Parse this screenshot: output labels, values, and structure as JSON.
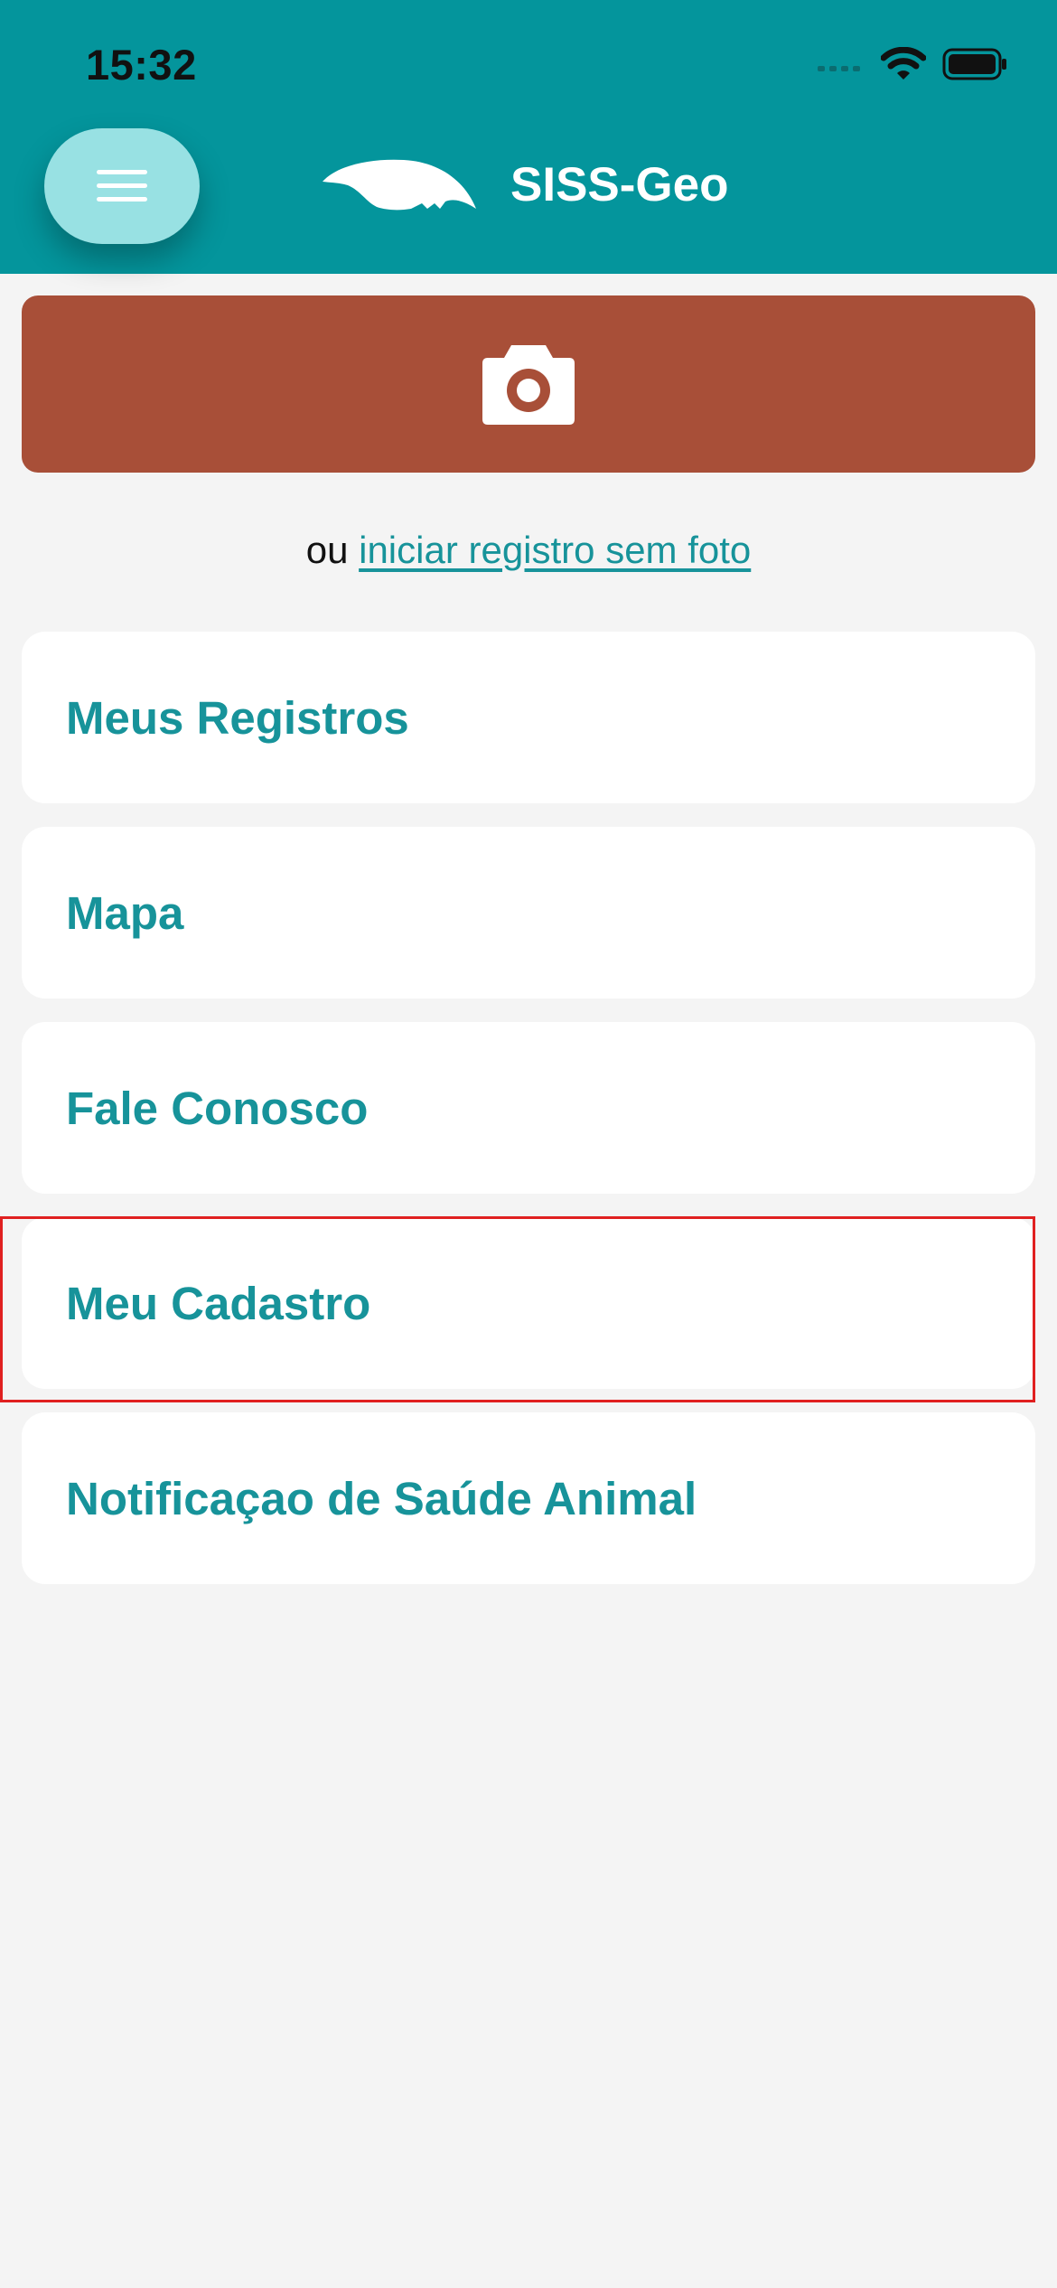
{
  "status_bar": {
    "time": "15:32"
  },
  "header": {
    "title": "SISS-Geo",
    "menu_icon": "hamburger-icon",
    "logo_icon": "anteater-logo-icon",
    "background_color": "#04959c"
  },
  "camera_button": {
    "icon": "camera-icon",
    "color": "#a84f38"
  },
  "no_photo": {
    "prefix": "ou",
    "link": "iniciar registro sem foto"
  },
  "menu": {
    "items": [
      {
        "label": "Meus Registros"
      },
      {
        "label": "Mapa"
      },
      {
        "label": "Fale Conosco"
      },
      {
        "label": "Meu Cadastro"
      },
      {
        "label": "Notificaçao de Saúde Animal"
      }
    ],
    "label_color": "#17939a"
  },
  "highlight_color": "#e02020"
}
